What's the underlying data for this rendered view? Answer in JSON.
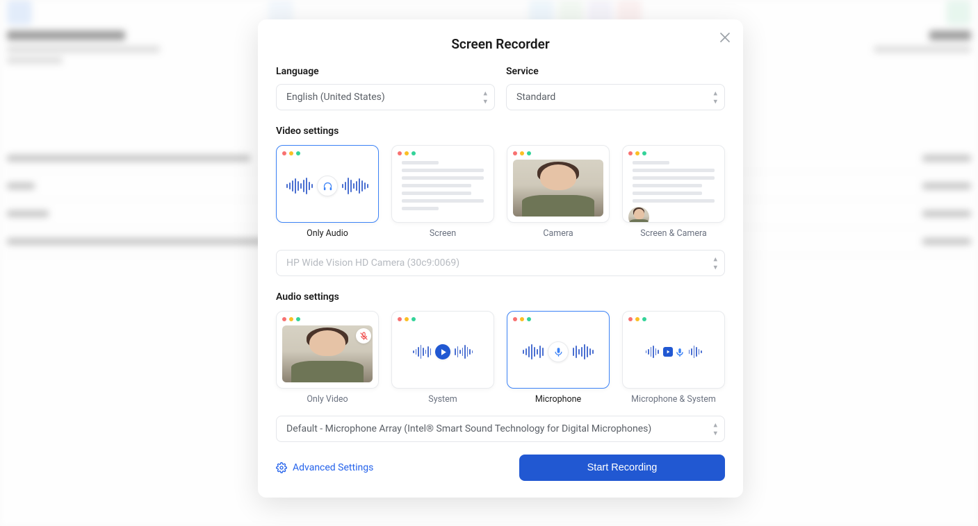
{
  "modal": {
    "title": "Screen Recorder",
    "language_label": "Language",
    "language_value": "English (United States)",
    "service_label": "Service",
    "service_value": "Standard",
    "video_settings_label": "Video settings",
    "video_options": {
      "only_audio": "Only Audio",
      "screen": "Screen",
      "camera": "Camera",
      "screen_camera": "Screen & Camera"
    },
    "camera_device": "HP Wide Vision HD Camera (30c9:0069)",
    "audio_settings_label": "Audio settings",
    "audio_options": {
      "only_video": "Only Video",
      "system": "System",
      "microphone": "Microphone",
      "mic_system": "Microphone & System"
    },
    "mic_device": "Default - Microphone Array (Intel® Smart Sound Technology for Digital Microphones)",
    "advanced_settings": "Advanced Settings",
    "start_button": "Start Recording"
  }
}
